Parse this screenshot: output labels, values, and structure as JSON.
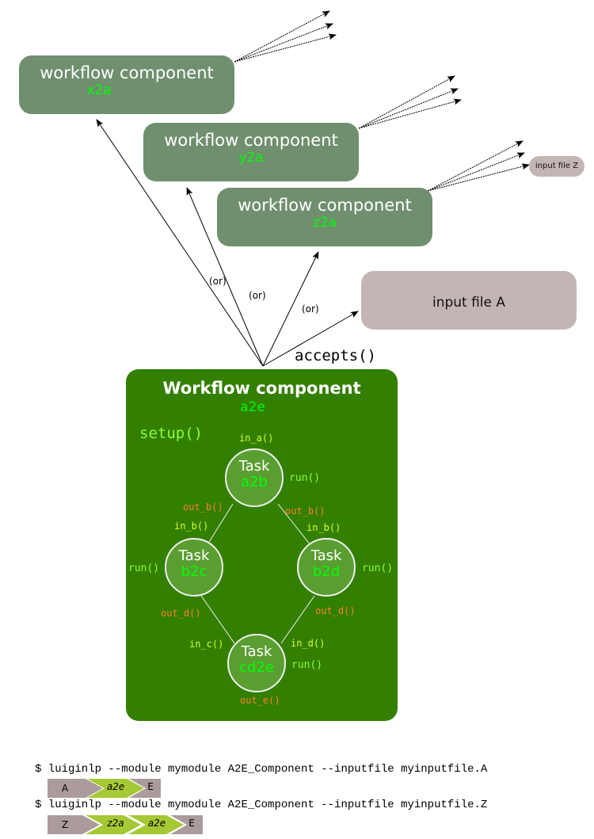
{
  "upstream_components": [
    {
      "title": "workflow component",
      "name": "x2a"
    },
    {
      "title": "workflow component",
      "name": "y2a"
    },
    {
      "title": "workflow component",
      "name": "z2a"
    }
  ],
  "input_file_a": "input file A",
  "input_file_z": "input file Z",
  "or_label": "(or)",
  "accepts_label": "accepts()",
  "main_component": {
    "title": "Workflow component",
    "name": "a2e",
    "setup_label": "setup()"
  },
  "tasks": [
    {
      "title": "Task",
      "name": "a2b"
    },
    {
      "title": "Task",
      "name": "b2c"
    },
    {
      "title": "Task",
      "name": "b2d"
    },
    {
      "title": "Task",
      "name": "cd2e"
    }
  ],
  "method_labels": {
    "in_a": "in_a()",
    "run": "run()",
    "out_b": "out_b()",
    "in_b": "in_b()",
    "out_d": "out_d()",
    "in_c": "in_c()",
    "in_d": "in_d()",
    "out_e": "out_e()"
  },
  "commands": [
    {
      "text": "$ luiginlp --module mymodule A2E_Component --inputfile myinputfile.A",
      "pipeline": [
        "A",
        "a2e",
        "E"
      ]
    },
    {
      "text": "$ luiginlp --module mymodule A2E_Component --inputfile myinputfile.Z",
      "pipeline": [
        "Z",
        "z2a",
        "a2e",
        "E"
      ]
    }
  ],
  "colors": {
    "component_box": "#6f8f6f",
    "main_box": "#337f00",
    "task_fill": "#5a9e31",
    "name_green": "#00ff00",
    "in_color": "#d4ff2a",
    "out_color": "#ff7f2a",
    "file_box": "#c4b5b5",
    "pipeline_file": "#ab9b9b",
    "pipeline_step": "#a5c934"
  }
}
